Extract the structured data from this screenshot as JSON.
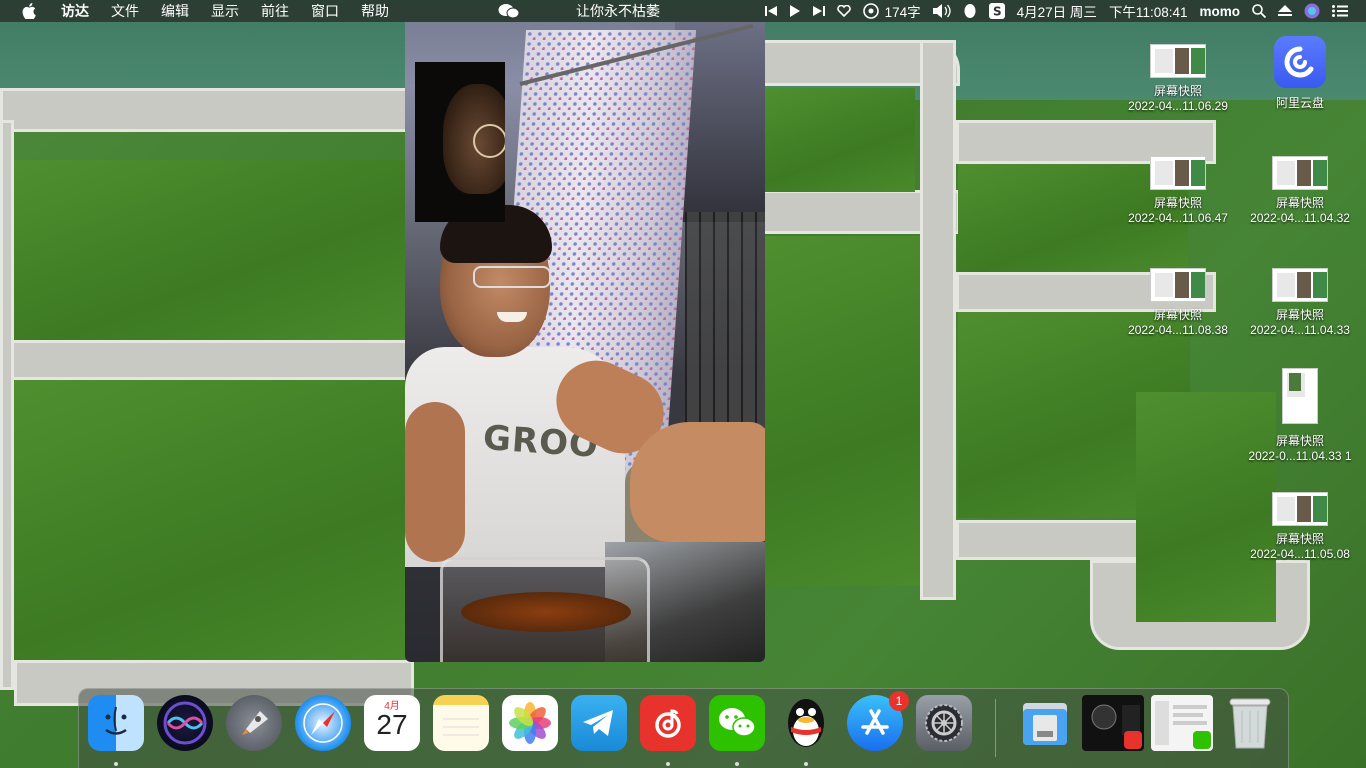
{
  "menubar": {
    "app_name": "访达",
    "menus": [
      "文件",
      "编辑",
      "显示",
      "前往",
      "窗口",
      "帮助"
    ],
    "now_playing": "让你永不枯萎",
    "word_count": "174字",
    "date": "4月27日 周三",
    "time": "下午11:08:41",
    "user": "momo"
  },
  "desktop": {
    "icons": [
      {
        "name": "屏幕快照",
        "sub": "2022-04...11.06.29"
      },
      {
        "name": "阿里云盘",
        "sub": ""
      },
      {
        "name": "屏幕快照",
        "sub": "2022-04...11.06.47"
      },
      {
        "name": "屏幕快照",
        "sub": "2022-04...11.04.32"
      },
      {
        "name": "屏幕快照",
        "sub": "2022-04...11.08.38"
      },
      {
        "name": "屏幕快照",
        "sub": "2022-04...11.04.33"
      },
      {
        "name": "屏幕快照",
        "sub": "2022-0...11.04.33 1"
      },
      {
        "name": "屏幕快照",
        "sub": "2022-04...11.05.08"
      }
    ]
  },
  "video_call": {
    "shirt_text": "GROO"
  },
  "dock": {
    "calendar_month": "4月",
    "calendar_day": "27",
    "appstore_badge": "1"
  }
}
